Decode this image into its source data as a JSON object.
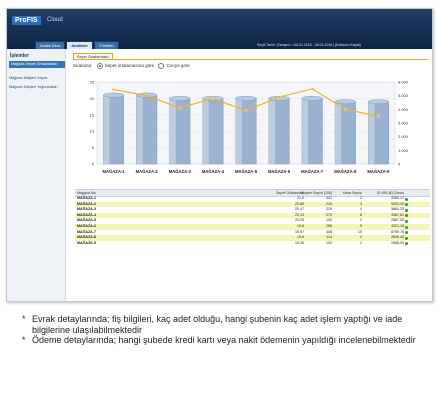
{
  "app": {
    "logo": "ProFIS",
    "subtitle": "Cloud"
  },
  "tabs": [
    {
      "label": "Analiz Ekra"
    },
    {
      "label": "Analizler"
    },
    {
      "label": "Yönetim"
    }
  ],
  "userbar": "Seçili Tarihi: (Tarayıcı: • 06.01.2016 - 06.01.2016 | [Kullanıcı Kapat]",
  "sidebar": {
    "title": "İşlemler",
    "items": [
      {
        "label": "Mağaza Sepet Ortalamaları",
        "selected": true
      },
      {
        "label": "Mağaza Müşteri Sayısı",
        "selected": false
      },
      {
        "label": "Mağaza Müşteri Yoğunlukları",
        "selected": false
      }
    ]
  },
  "subtab": "Sepet Ortalamaları",
  "filters": {
    "label": "Sıralama:",
    "option1": "Sepet ortalamasına göre",
    "option2": "Ciroya göre"
  },
  "chart_data": {
    "type": "bar",
    "categories": [
      "MAĞAZA-1",
      "MAĞAZA-2",
      "MAĞAZA-3",
      "MAĞAZA-4",
      "MAĞAZA-5",
      "MAĞAZA-6",
      "MAĞAZA-7",
      "MAĞAZA-8",
      "MAĞAZA-9"
    ],
    "series": [
      {
        "values": [
          21,
          21,
          20,
          20,
          20,
          20,
          20,
          19,
          19
        ]
      },
      {
        "values": [
          5450,
          5002,
          4100,
          4800,
          3900,
          4900,
          5500,
          4000,
          3500
        ]
      }
    ],
    "ylim": [
      0,
      25
    ],
    "y_ticks": [
      "0",
      "5",
      "10",
      "15",
      "20",
      "25"
    ],
    "y2lim": [
      0,
      6000
    ],
    "y2_ticks": [
      "0",
      "1.000",
      "2.000",
      "3.000",
      "4.000",
      "5.000",
      "6.000"
    ],
    "colors": {
      "bar": "#9ab2d0",
      "line": "#f0b030"
    }
  },
  "table": {
    "headers": [
      "Mağaza Adı",
      "Sepet Ortalaması",
      "Müşteri Sayısı [106]",
      "Kasa Sayısı",
      "ID.990 [€] Cirosu"
    ],
    "rows": [
      [
        "MAĞAZA-1",
        "21,0",
        "331",
        "2",
        "3360,17"
      ],
      [
        "MAĞAZA-2",
        "20,60",
        "243",
        "3",
        "5002,20"
      ],
      [
        "MAĞAZA-3",
        "20,47",
        "229",
        "4",
        "3881,22"
      ],
      [
        "MAĞAZA-4",
        "20,13",
        "270",
        "6",
        "3387,61"
      ],
      [
        "MAĞAZA-5",
        "20,05",
        "140",
        "2",
        "2867,05"
      ],
      [
        "MAĞAZA-6",
        "19,8",
        "258",
        "5",
        "4321,18"
      ],
      [
        "MAĞAZA-7",
        "19,97",
        "448",
        "10",
        "8769,78"
      ],
      [
        "MAĞAZA-8",
        "19,6",
        "114",
        "2",
        "2849,40"
      ],
      [
        "MAĞAZA-9",
        "19,26",
        "102",
        "2",
        "1965,09"
      ]
    ]
  },
  "notes": [
    "Evrak detaylarında; fiş bilgileri, kaç adet olduğu, hangi şubenin kaç adet işlem yaptığı ve iade bilgilerine ulaşılabilmektedir",
    "Ödeme detaylarında; hangi şubede kredi kartı veya nakit ödemenin yapıldığı incelenebilmektedir"
  ],
  "note_bullet": "*"
}
